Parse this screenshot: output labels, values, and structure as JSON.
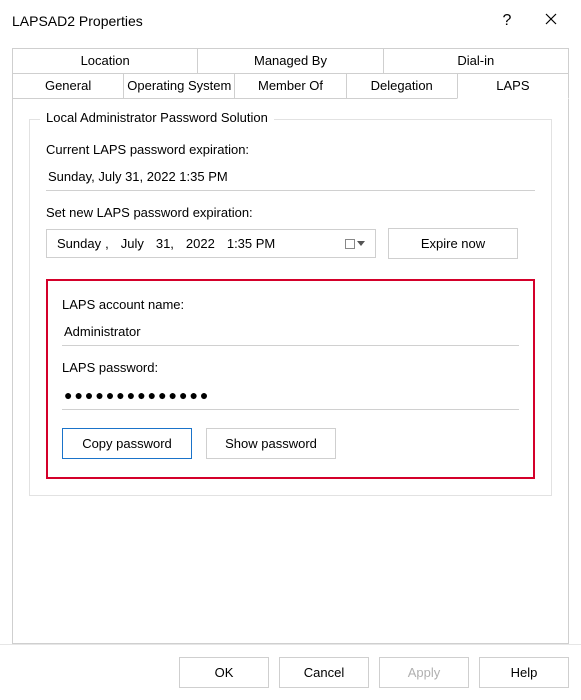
{
  "title": "LAPSAD2 Properties",
  "titlebar": {
    "help_glyph": "?",
    "close_glyph": "✕"
  },
  "tabs": {
    "row1": [
      "Location",
      "Managed By",
      "Dial-in"
    ],
    "row2": [
      "General",
      "Operating System",
      "Member Of",
      "Delegation",
      "LAPS"
    ],
    "active": "LAPS"
  },
  "group": {
    "legend": "Local Administrator Password Solution",
    "current_exp_label": "Current LAPS password expiration:",
    "current_exp_value": "Sunday, July 31, 2022 1:35 PM",
    "set_new_label": "Set new LAPS password expiration:",
    "datetime": {
      "weekday": "Sunday",
      "month": "July",
      "day": "31,",
      "year": "2022",
      "time": "1:35 PM"
    },
    "expire_now": "Expire now",
    "account_label": "LAPS account name:",
    "account_value": "Administrator",
    "password_label": "LAPS password:",
    "password_mask": "●●●●●●●●●●●●●●",
    "copy_btn": "Copy password",
    "show_btn": "Show password"
  },
  "footer": {
    "ok": "OK",
    "cancel": "Cancel",
    "apply": "Apply",
    "help": "Help"
  }
}
